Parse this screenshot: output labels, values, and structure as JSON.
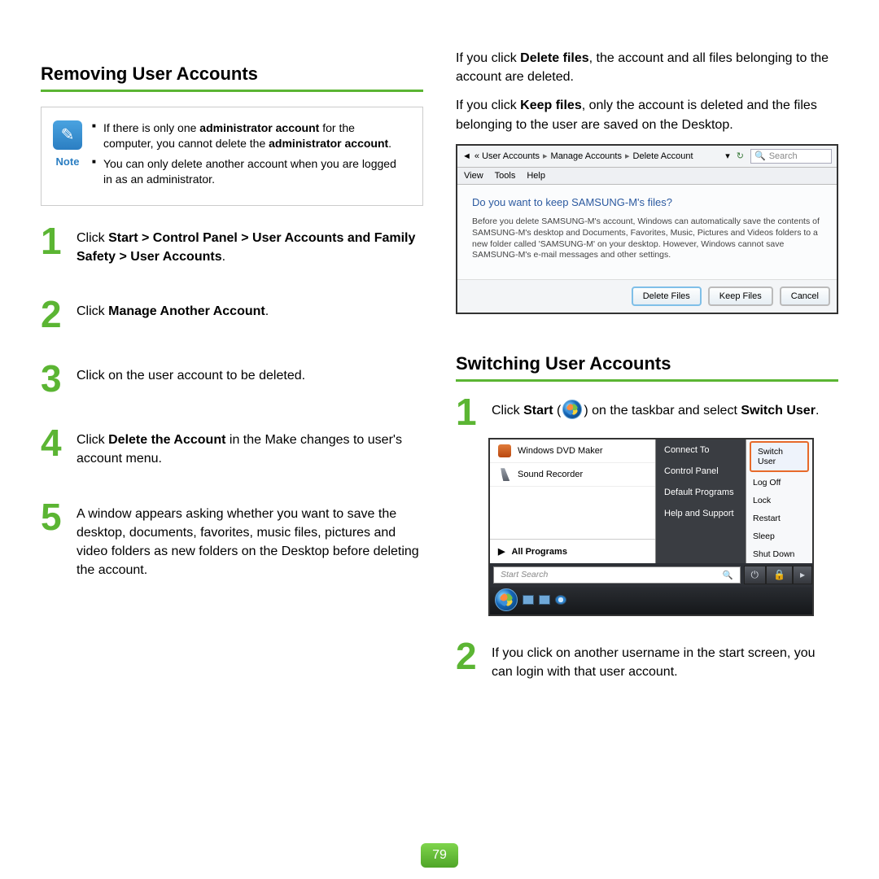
{
  "page_number": "79",
  "left": {
    "heading": "Removing User Accounts",
    "note": {
      "label": "Note",
      "items": [
        {
          "pre": "If there is only one ",
          "b1": "administrator account",
          "mid": " for the computer, you cannot delete the ",
          "b2": "administrator account",
          "post": "."
        },
        {
          "text": "You can only delete another account when you are logged in as an administrator."
        }
      ]
    },
    "steps": [
      {
        "n": "1",
        "parts": [
          "Click ",
          {
            "b": "Start > Control Panel > User Accounts and Family Safety > User Accounts"
          },
          "."
        ]
      },
      {
        "n": "2",
        "parts": [
          "Click ",
          {
            "b": "Manage Another Account"
          },
          "."
        ]
      },
      {
        "n": "3",
        "parts": [
          "Click on the user account to be deleted."
        ]
      },
      {
        "n": "4",
        "parts": [
          "Click ",
          {
            "b": "Delete the Account"
          },
          " in the Make changes to user's account menu."
        ]
      },
      {
        "n": "5",
        "parts": [
          "A window appears asking whether you want to save the desktop, documents, favorites, music files, pictures and video folders as new folders on the Desktop before deleting the account."
        ]
      }
    ]
  },
  "right": {
    "paragraphs": [
      [
        "If you click ",
        {
          "b": "Delete files"
        },
        ", the account and all files belonging to the account are deleted."
      ],
      [
        "If you click ",
        {
          "b": "Keep files"
        },
        ", only the account is deleted and the files belonging to the user are saved on the Desktop."
      ]
    ],
    "shot1": {
      "crumbs": [
        "User Accounts",
        "Manage Accounts",
        "Delete Account"
      ],
      "search_placeholder": "Search",
      "menu": [
        "View",
        "Tools",
        "Help"
      ],
      "question": "Do you want to keep SAMSUNG-M's files?",
      "desc": "Before you delete SAMSUNG-M's account, Windows can automatically save the contents of SAMSUNG-M's desktop and Documents, Favorites, Music, Pictures and Videos folders to a new folder called 'SAMSUNG-M' on your desktop. However, Windows cannot save SAMSUNG-M's e-mail messages and other settings.",
      "buttons": [
        "Delete Files",
        "Keep Files",
        "Cancel"
      ]
    },
    "heading2": "Switching User Accounts",
    "steps": [
      {
        "n": "1",
        "pre": "Click ",
        "b1": "Start",
        "mid1": " (",
        "mid2": ") on the taskbar and select ",
        "b2": "Switch User",
        "post": "."
      },
      {
        "n": "2",
        "text": "If you click on another username in the start screen, you can login with that user account."
      }
    ],
    "shot2": {
      "left_items": [
        "Windows DVD Maker",
        "Sound Recorder"
      ],
      "all_programs": "All Programs",
      "search_placeholder": "Start Search",
      "right1": [
        "Connect To",
        "Control Panel",
        "Default Programs",
        "Help and Support"
      ],
      "right2": [
        "Switch User",
        "Log Off",
        "Lock",
        "Restart",
        "Sleep",
        "Shut Down"
      ]
    }
  }
}
